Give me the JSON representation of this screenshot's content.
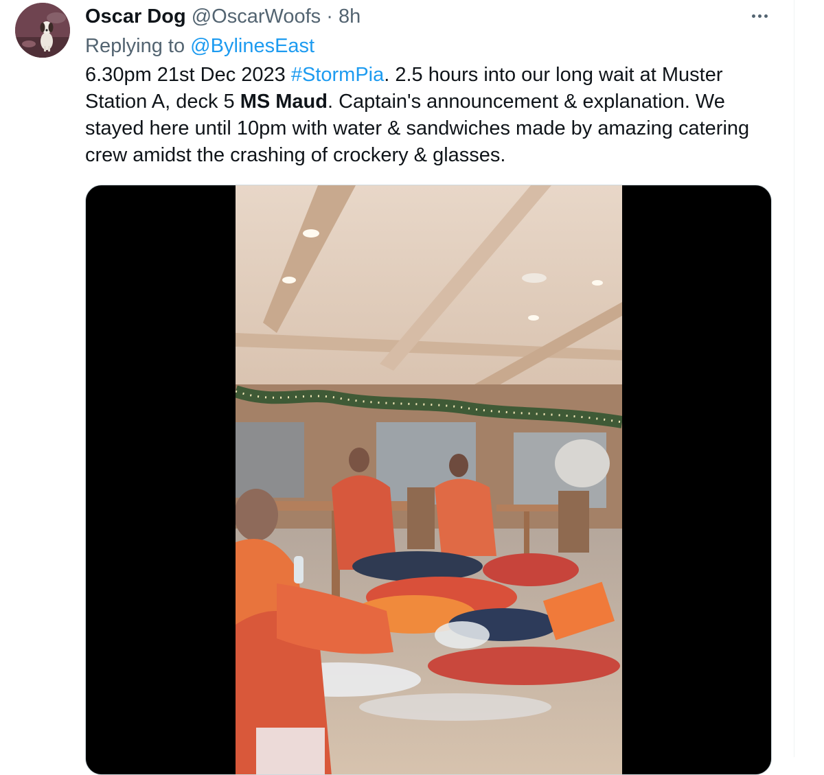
{
  "tweet": {
    "author": {
      "display_name": "Oscar Dog",
      "handle": "@OscarWoofs",
      "separator": "·",
      "time": "8h",
      "avatar_icon": "dog-photo-avatar"
    },
    "more_icon": "more-horizontal-icon",
    "reply": {
      "prefix": "Replying to ",
      "mention": "@BylinesEast"
    },
    "text": {
      "l1_a": "6.30pm 21st Dec 2023 ",
      "l1_hashtag": "#StormPia",
      "l1_b": ".  2.5 hours into our long wait at Muster",
      "l2_a": "Station A, deck 5 ",
      "l2_bold": "MS Maud",
      "l2_b": ". Captain's announcement & explanation. We",
      "l3": "stayed here until 10pm with water & sandwiches made by amazing catering",
      "l4": "crew amidst the crashing of crockery & glasses."
    },
    "media": {
      "kind": "video",
      "scene_icon": "video-still-muster-station"
    },
    "colors": {
      "link": "#1d9bf0",
      "text": "#0f1419",
      "secondary": "#536471"
    }
  }
}
